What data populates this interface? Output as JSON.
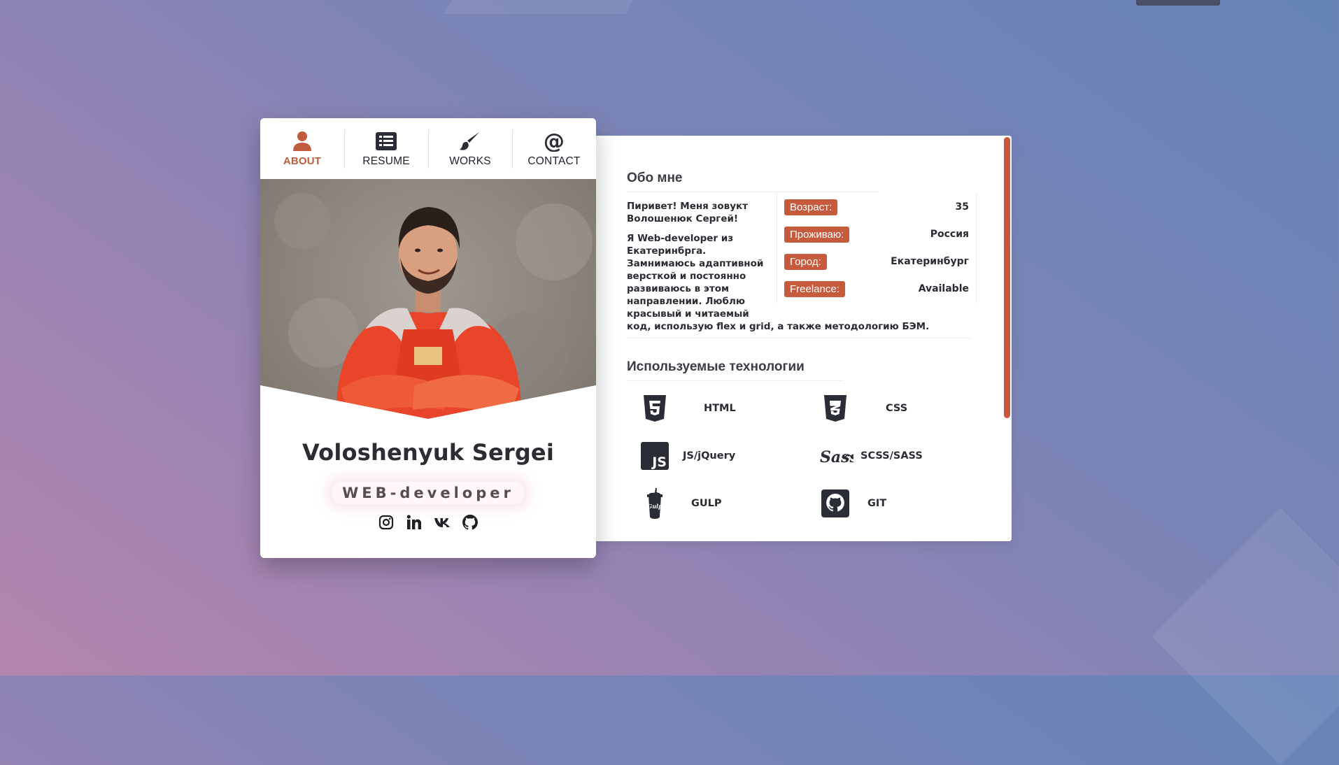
{
  "nav": {
    "items": [
      {
        "label": "ABOUT",
        "icon": "user-icon"
      },
      {
        "label": "RESUME",
        "icon": "list-icon"
      },
      {
        "label": "WORKS",
        "icon": "brush-icon"
      },
      {
        "label": "CONTACT",
        "icon": "at-icon"
      }
    ],
    "active": "ABOUT"
  },
  "profile": {
    "name": "Voloshenyuk Sergei",
    "role": "WEB-developer",
    "socials": [
      "instagram-icon",
      "linkedin-icon",
      "vk-icon",
      "github-icon"
    ]
  },
  "about": {
    "title": "Обо мне",
    "greeting": "Пиривет! Меня зовукт Волошенюк Сергей!",
    "paragraph_lines": [
      "Я Web-developer из",
      "Екатеринбрга.",
      "Замнимаюсь адаптивной",
      "версткой и постоянно",
      "развиваюсь в этом",
      "направлении. Люблю",
      "красывый и читаемый",
      "код, использую flex и grid, а также методологию БЭМ."
    ],
    "info": [
      {
        "key": "Возраст:",
        "value": "35"
      },
      {
        "key": "Проживаю:",
        "value": "Россия"
      },
      {
        "key": "Город:",
        "value": "Екатеринбург"
      },
      {
        "key": "Freelance:",
        "value": "Available"
      }
    ]
  },
  "tech": {
    "title": "Используемые технологии",
    "items": [
      {
        "label": "HTML",
        "icon": "html5-icon"
      },
      {
        "label": "CSS",
        "icon": "css3-icon"
      },
      {
        "label": "JS/jQuery",
        "icon": "js-icon"
      },
      {
        "label": "SCSS/SASS",
        "icon": "sass-icon"
      },
      {
        "label": "GULP",
        "icon": "gulp-icon"
      },
      {
        "label": "GIT",
        "icon": "github-icon"
      }
    ]
  },
  "colors": {
    "accent": "#c65a3d",
    "text_dark": "#2b2b33"
  }
}
